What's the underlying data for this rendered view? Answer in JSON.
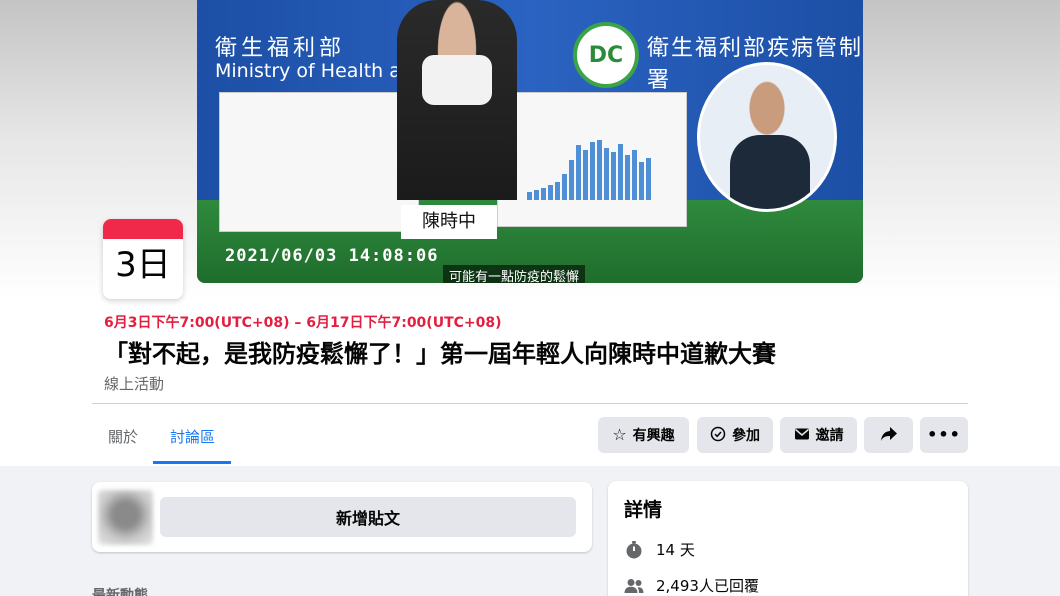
{
  "cover": {
    "ministry_cn": "衛生福利部",
    "ministry_en": "Ministry of Health and Welfare",
    "cdc_name": "衛生福利部疾病管制署",
    "nameplate": "陳時中",
    "timestamp": "2021/06/03 14:08:06",
    "subtitle": "可能有一點防疫的鬆懈"
  },
  "calendar": {
    "day": "3日"
  },
  "event": {
    "date_range": "6月3日下午7:00(UTC+08) – 6月17日下午7:00(UTC+08)",
    "title": "「對不起，是我防疫鬆懈了！」第一屆年輕人向陳時中道歉大賽",
    "type": "線上活動"
  },
  "tabs": [
    {
      "label": "關於",
      "active": false
    },
    {
      "label": "討論區",
      "active": true
    }
  ],
  "actions": {
    "interested": {
      "label": "有興趣",
      "icon": "star-icon"
    },
    "going": {
      "label": "參加",
      "icon": "check-circle-icon"
    },
    "invite": {
      "label": "邀請",
      "icon": "envelope-icon"
    },
    "share": {
      "icon": "share-arrow-icon"
    },
    "more": {
      "icon": "more-dots-icon"
    }
  },
  "composer": {
    "new_post_label": "新增貼文"
  },
  "feed": {
    "latest_label": "最新動態"
  },
  "details": {
    "title": "詳情",
    "duration": "14 天",
    "responses": "2,493人已回覆"
  },
  "colors": {
    "accent": "#1877f2",
    "date_red": "#e41e3f",
    "button_bg": "#e4e6eb",
    "page_bg": "#f0f2f5"
  }
}
